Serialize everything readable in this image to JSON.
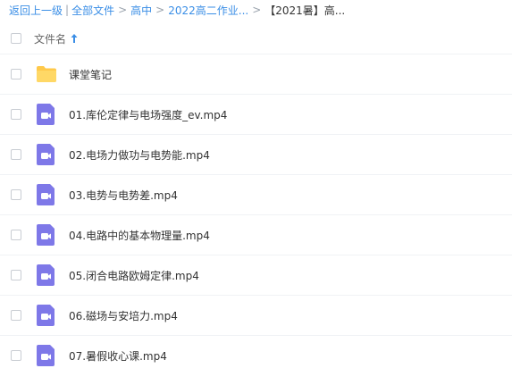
{
  "breadcrumb": {
    "back": "返回上一级",
    "pipe": "|",
    "all_files": "全部文件",
    "sep": ">",
    "level1": "高中",
    "level2": "2022高二作业...",
    "current": "【2021暑】高..."
  },
  "header": {
    "name_label": "文件名"
  },
  "files": [
    {
      "name": "课堂笔记",
      "type": "folder-icon"
    },
    {
      "name": "01.库伦定律与电场强度_ev.mp4",
      "type": "video-icon"
    },
    {
      "name": "02.电场力做功与电势能.mp4",
      "type": "video-icon"
    },
    {
      "name": "03.电势与电势差.mp4",
      "type": "video-icon"
    },
    {
      "name": "04.电路中的基本物理量.mp4",
      "type": "video-icon"
    },
    {
      "name": "05.闭合电路欧姆定律.mp4",
      "type": "video-icon"
    },
    {
      "name": "06.磁场与安培力.mp4",
      "type": "video-icon"
    },
    {
      "name": "07.暑假收心课.mp4",
      "type": "video-icon"
    }
  ],
  "colors": {
    "link": "#3a8ee6",
    "folder": "#ffd15c",
    "video": "#7e78e8"
  }
}
